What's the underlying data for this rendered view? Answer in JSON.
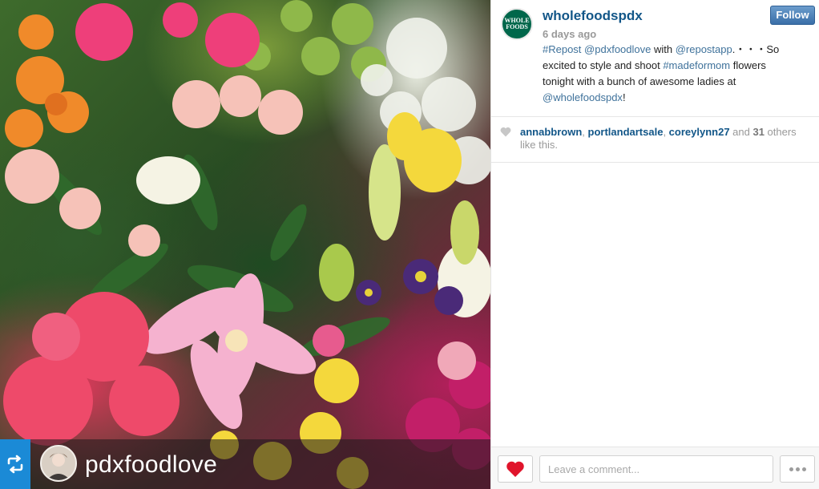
{
  "post": {
    "username": "wholefoodspdx",
    "timestamp": "6 days ago",
    "follow_label": "Follow",
    "brand_avatar_text": "WHOLE FOODS",
    "caption": {
      "repost_tag": "#Repost",
      "original_user": "@pdxfoodlove",
      "with_text": " with ",
      "app_user": "@repostapp",
      "text1": ".・・・So excited to style and shoot ",
      "hashtag": "#madeformom",
      "text2": " flowers tonight with a bunch of awesome ladies at ",
      "mention": "@wholefoodspdx",
      "text3": "!"
    }
  },
  "photo": {
    "repost_icon": "repost-icon",
    "poster_name": "pdxfoodlove"
  },
  "likes": {
    "users": [
      "annabbrown",
      "portlandartsale",
      "coreylynn27"
    ],
    "sep1": ", ",
    "sep2": ", ",
    "and_text": " and ",
    "others_count": "31",
    "others_text": " others like this.",
    "icon": "heart-icon"
  },
  "footer": {
    "like_icon": "heart-icon",
    "comment_placeholder": "Leave a comment...",
    "more_icon": "more-icon"
  },
  "colors": {
    "link": "#125688",
    "hashtag": "#3f729b",
    "follow_button": "#3a6fa8",
    "repost_badge": "#1b8ad6",
    "heart_active": "#e0142b",
    "brand_green": "#00674b"
  }
}
